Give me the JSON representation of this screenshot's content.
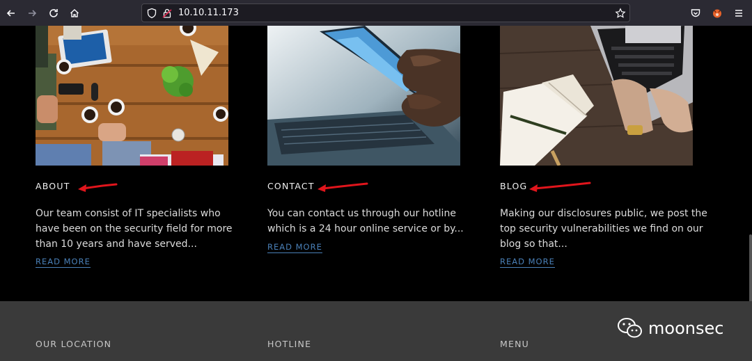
{
  "browser": {
    "url": "10.10.11.173"
  },
  "cards": [
    {
      "title": "ABOUT",
      "text": "Our team consist of IT specialists who have been on the security field for more than 10 years and have served...",
      "link": "READ MORE",
      "image": "team-meeting-table"
    },
    {
      "title": "CONTACT",
      "text": "You can contact us through our hotline which is a 24 hour online service or by...",
      "link": "READ MORE",
      "image": "hand-holding-phone"
    },
    {
      "title": "BLOG",
      "text": "Making our disclosures public, we post the top security vulnerabilities we find on our blog so that...",
      "link": "READ MORE",
      "image": "laptop-notebook-desk"
    }
  ],
  "footer": {
    "columns": [
      "OUR LOCATION",
      "HOTLINE",
      "MENU"
    ],
    "watermark": "moonsec"
  },
  "colors": {
    "accent_link": "#4a80b8",
    "annotation_arrow": "#e0151c",
    "footer_bg": "#3a3a3a"
  }
}
